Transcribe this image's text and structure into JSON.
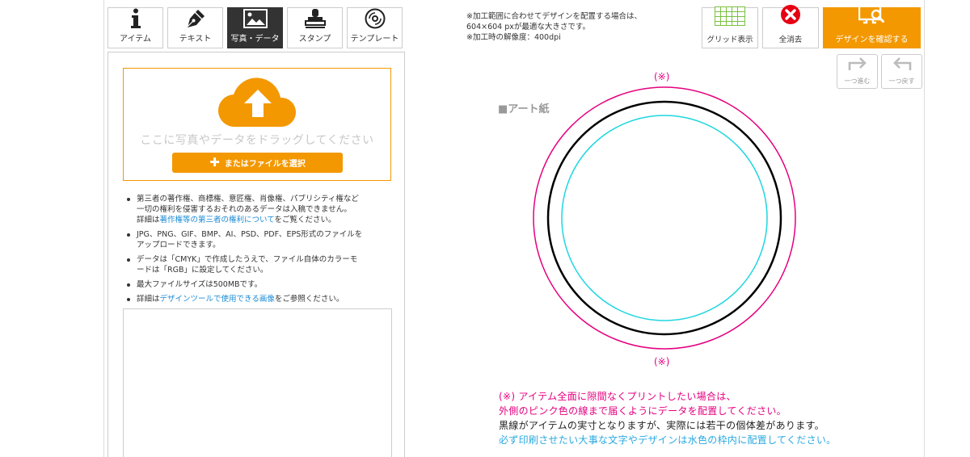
{
  "tabs": [
    {
      "label": "アイテム",
      "icon": "info-icon",
      "active": false
    },
    {
      "label": "テキスト",
      "icon": "pen-icon",
      "active": false
    },
    {
      "label": "写真・データ",
      "icon": "image-icon",
      "active": true
    },
    {
      "label": "スタンプ",
      "icon": "stamp-icon",
      "active": false
    },
    {
      "label": "テンプレート",
      "icon": "disc-icon",
      "active": false
    }
  ],
  "upload": {
    "drop_text": "ここに写真やデータをドラッグしてください",
    "select_button": "またはファイルを選択",
    "icon": "cloud-upload-icon"
  },
  "notes": {
    "n1_line1": "第三者の著作権、商標権、意匠権、肖像権、パブリシティ権など",
    "n1_line2": "一切の権利を侵害するおそれのあるデータは入稿できません。",
    "n1_line3_pre": "詳細は",
    "n1_line3_link": "著作権等の第三者の権利について",
    "n1_line3_post": "をご覧ください。",
    "n2_line1": "JPG、PNG、GIF、BMP、AI、PSD、PDF、EPS形式のファイルを",
    "n2_line2": "アップロードできます。",
    "n3_line1": "データは「CMYK」で作成したうえで、ファイル自体のカラーモ",
    "n3_line2": "ードは「RGB」に設定してください。",
    "n4": "最大ファイルサイズは500MBです。",
    "n5_pre": "詳細は",
    "n5_link": "デザインツールで使用できる画像",
    "n5_post": "をご参照ください。"
  },
  "info": {
    "line1": "※加工範囲に合わせてデザインを配置する場合は、",
    "line2": "604×604 pxが最適な大きさです。",
    "line3": "※加工時の解像度：400dpi"
  },
  "toolbar": {
    "grid_label": "グリッド表示",
    "clear_label": "全消去",
    "confirm_label": "デザインを確認する",
    "redo_label": "一つ進む",
    "undo_label": "一つ戻す"
  },
  "canvas": {
    "paper_label": "■アート紙",
    "mark_top": "(※)",
    "mark_bottom": "(※)"
  },
  "legend": {
    "line1": "(※) アイテム全面に隙間なくプリントしたい場合は、",
    "line2": "外側のピンク色の線まで届くようにデータを配置してください。",
    "line3": "黒線がアイテムの実寸となりますが、実際には若干の個体差があります。",
    "line4": "必ず印刷させたい大事な文字やデザインは水色の枠内に配置してください。"
  },
  "colors": {
    "accent": "#f39800",
    "bleed_line": "#e5007f",
    "trim_line": "#000000",
    "safe_line": "#1fd6e0",
    "clear_icon": "#e60012",
    "grid_icon": "#7bc043"
  }
}
